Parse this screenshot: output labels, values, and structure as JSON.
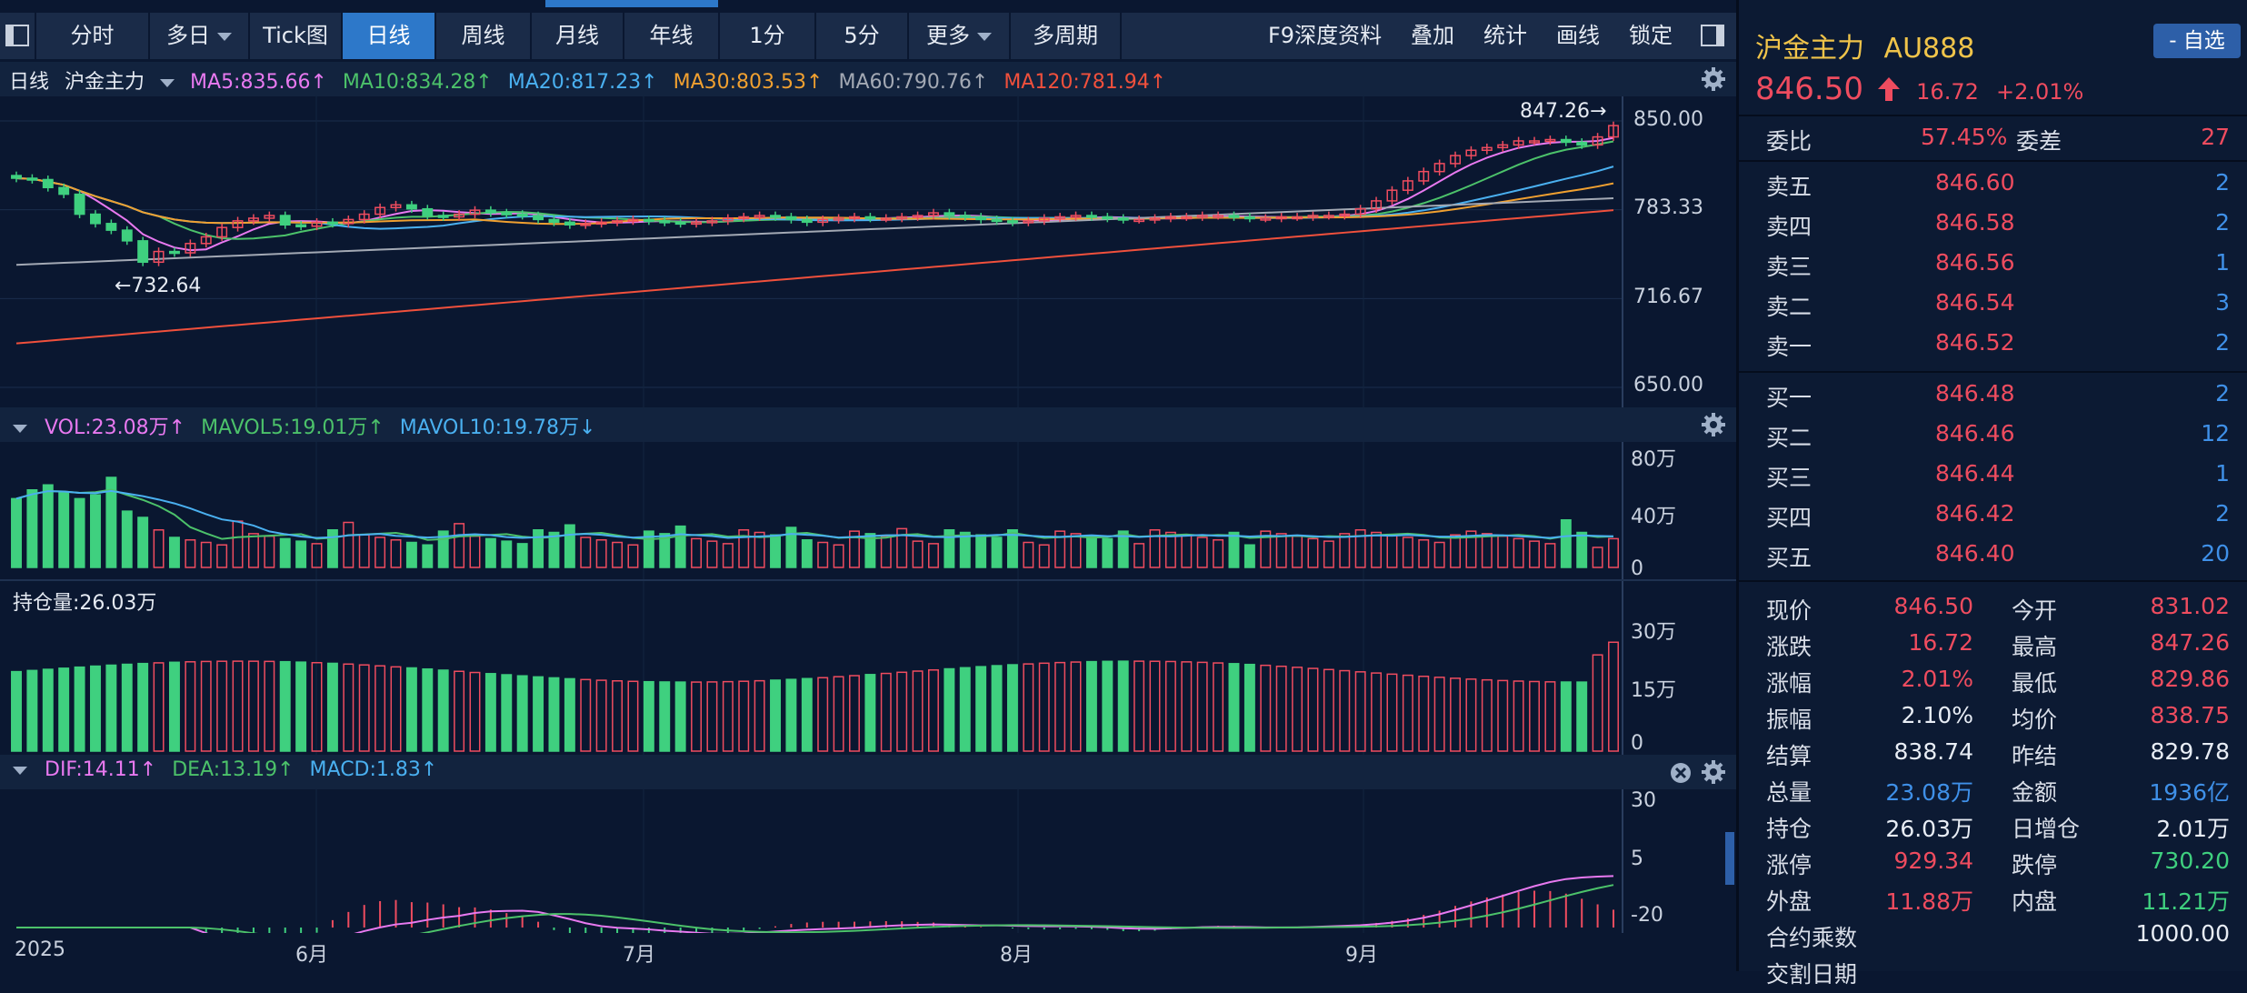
{
  "toolbar": {
    "tabs": [
      "分时",
      "多日",
      "Tick图",
      "日线",
      "周线",
      "月线",
      "年线",
      "1分",
      "5分",
      "更多",
      "多周期"
    ],
    "active": "日线",
    "right_items": [
      "F9深度资料",
      "叠加",
      "统计",
      "画线",
      "锁定"
    ]
  },
  "main_legend": {
    "period": "日线",
    "name": "沪金主力",
    "items": [
      {
        "text": "MA5:835.66↑",
        "color": "#e879f0"
      },
      {
        "text": "MA10:834.28↑",
        "color": "#4cc26a"
      },
      {
        "text": "MA20:817.23↑",
        "color": "#4ab0f0"
      },
      {
        "text": "MA30:803.53↑",
        "color": "#f0a030"
      },
      {
        "text": "MA60:790.76↑",
        "color": "#a3a9b4"
      },
      {
        "text": "MA120:781.94↑",
        "color": "#f0503c"
      }
    ],
    "high_label": "847.26→",
    "low_label": "←732.64",
    "y_ticks": [
      "850.00",
      "783.33",
      "716.67",
      "650.00"
    ]
  },
  "vol_legend": {
    "items": [
      {
        "text": "VOL:23.08万↑",
        "color": "#e879f0"
      },
      {
        "text": "MAVOL5:19.01万↑",
        "color": "#4cc26a"
      },
      {
        "text": "MAVOL10:19.78万↓",
        "color": "#4ab0f0"
      }
    ],
    "y_ticks": [
      "80万",
      "40万",
      "0"
    ]
  },
  "oi_legend": {
    "text": "持仓量:26.03万",
    "y_ticks": [
      "30万",
      "15万",
      "0"
    ]
  },
  "macd_legend": {
    "items": [
      {
        "text": "DIF:14.11↑",
        "color": "#e879f0"
      },
      {
        "text": "DEA:13.19↑",
        "color": "#4cc26a"
      },
      {
        "text": "MACD:1.83↑",
        "color": "#4ab0f0"
      }
    ],
    "y_ticks": [
      "30",
      "5",
      "-20"
    ]
  },
  "x_axis": [
    "2025",
    "6月",
    "7月",
    "8月",
    "9月"
  ],
  "quote": {
    "name": "沪金主力",
    "code": "AU888",
    "watch_btn": "- 自选",
    "price": "846.50",
    "change": "16.72",
    "change_pct": "+2.01%",
    "weibi_label": "委比",
    "weibi": "57.45%",
    "weicha_label": "委差",
    "weicha": "27",
    "asks": [
      {
        "label": "卖五",
        "price": "846.60",
        "qty": "2"
      },
      {
        "label": "卖四",
        "price": "846.58",
        "qty": "2"
      },
      {
        "label": "卖三",
        "price": "846.56",
        "qty": "1"
      },
      {
        "label": "卖二",
        "price": "846.54",
        "qty": "3"
      },
      {
        "label": "卖一",
        "price": "846.52",
        "qty": "2"
      }
    ],
    "bids": [
      {
        "label": "买一",
        "price": "846.48",
        "qty": "2"
      },
      {
        "label": "买二",
        "price": "846.46",
        "qty": "12"
      },
      {
        "label": "买三",
        "price": "846.44",
        "qty": "1"
      },
      {
        "label": "买四",
        "price": "846.42",
        "qty": "2"
      },
      {
        "label": "买五",
        "price": "846.40",
        "qty": "20"
      }
    ],
    "stats": [
      {
        "l1": "现价",
        "v1": "846.50",
        "c1": "red",
        "l2": "今开",
        "v2": "831.02",
        "c2": "red"
      },
      {
        "l1": "涨跌",
        "v1": "16.72",
        "c1": "red",
        "l2": "最高",
        "v2": "847.26",
        "c2": "red"
      },
      {
        "l1": "涨幅",
        "v1": "2.01%",
        "c1": "red",
        "l2": "最低",
        "v2": "829.86",
        "c2": "red"
      },
      {
        "l1": "振幅",
        "v1": "2.10%",
        "c1": "white",
        "l2": "均价",
        "v2": "838.75",
        "c2": "red"
      },
      {
        "l1": "结算",
        "v1": "838.74",
        "c1": "white",
        "l2": "昨结",
        "v2": "829.78",
        "c2": "white"
      },
      {
        "l1": "总量",
        "v1": "23.08万",
        "c1": "blue",
        "l2": "金额",
        "v2": "1936亿",
        "c2": "blue"
      },
      {
        "l1": "持仓",
        "v1": "26.03万",
        "c1": "white",
        "l2": "日增仓",
        "v2": "2.01万",
        "c2": "white"
      },
      {
        "l1": "涨停",
        "v1": "929.34",
        "c1": "red",
        "l2": "跌停",
        "v2": "730.20",
        "c2": "green"
      },
      {
        "l1": "外盘",
        "v1": "11.88万",
        "c1": "red",
        "l2": "内盘",
        "v2": "11.21万",
        "c2": "green"
      }
    ],
    "contract_label": "合约乘数",
    "contract_value": "1000.00",
    "delivery_label": "交割日期"
  },
  "chart_data": {
    "type": "candlestick",
    "title": "沪金主力 日线",
    "price_range": [
      650,
      850
    ],
    "ohlc_close": [
      807,
      806,
      800,
      795,
      780,
      773,
      768,
      760,
      744,
      752,
      751,
      758,
      763,
      770,
      775,
      777,
      779,
      772,
      771,
      774,
      773,
      776,
      780,
      785,
      787,
      784,
      779,
      778,
      780,
      783,
      781,
      780,
      779,
      776,
      774,
      772,
      773,
      774,
      775,
      776,
      775,
      774,
      773,
      774,
      775,
      777,
      778,
      779,
      778,
      776,
      774,
      776,
      777,
      778,
      777,
      777,
      778,
      779,
      781,
      779,
      778,
      776,
      775,
      774,
      775,
      777,
      778,
      779,
      778,
      777,
      776,
      776,
      777,
      778,
      778,
      779,
      779,
      778,
      777,
      777,
      778,
      778,
      779,
      779,
      780,
      784,
      790,
      798,
      805,
      812,
      818,
      824,
      828,
      830,
      832,
      835,
      835,
      836,
      834,
      832,
      838,
      846.5
    ],
    "highlight": {
      "high": 847.26,
      "low": 732.64
    },
    "volume_wan_range": [
      0,
      80
    ],
    "oi_wan_range": [
      0,
      30
    ],
    "macd_range": [
      -20,
      30
    ]
  }
}
